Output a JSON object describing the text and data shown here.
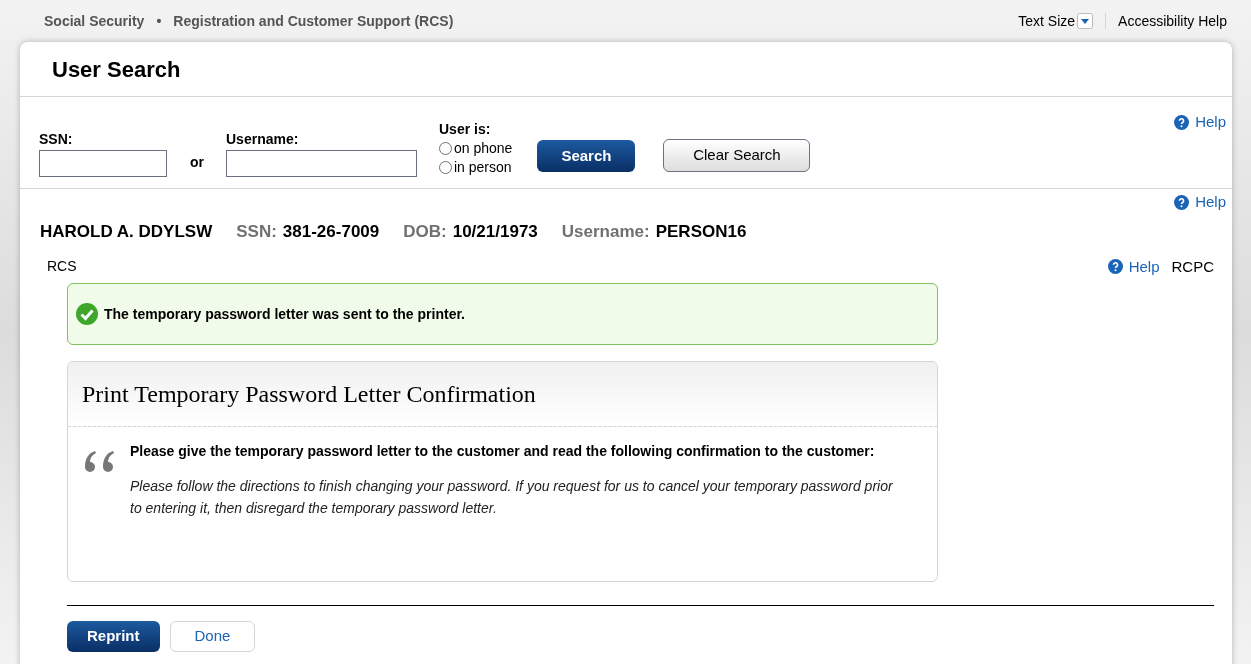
{
  "header": {
    "breadcrumb": [
      "Social Security",
      "•",
      "Registration and Customer Support (RCS)"
    ],
    "text_size": "Text Size",
    "accessibility": "Accessibility Help"
  },
  "title": "User Search",
  "search": {
    "ssn_label": "SSN:",
    "or": "or",
    "username_label": "Username:",
    "user_is": "User is:",
    "options": [
      {
        "label": "on phone",
        "selected": false
      },
      {
        "label": "in person",
        "selected": false
      }
    ],
    "search_button": "Search",
    "clear_button": "Clear Search",
    "help": "Help"
  },
  "person": {
    "help": "Help",
    "name": "HAROLD A. DDYLSW",
    "fields": [
      {
        "label": "SSN:",
        "value": "381-26-7009"
      },
      {
        "label": "DOB:",
        "value": "10/21/1973"
      },
      {
        "label": "Username:",
        "value": "PERSON16"
      }
    ]
  },
  "section": {
    "left": "RCS",
    "help": "Help",
    "right": "RCPC"
  },
  "alert": {
    "kind": "success",
    "text": "The temporary password letter was sent to the printer."
  },
  "panel": {
    "title": "Print Temporary Password Letter Confirmation",
    "instruction": "Please give the temporary password letter to the customer and read the following confirmation to the customer:",
    "quote": "Please follow the directions to finish changing your password. If you request for us to cancel your temporary password prior to entering it, then disregard the temporary password letter."
  },
  "buttons": [
    {
      "label": "Reprint",
      "kind": "primary"
    },
    {
      "label": "Done",
      "kind": "secondary"
    }
  ]
}
